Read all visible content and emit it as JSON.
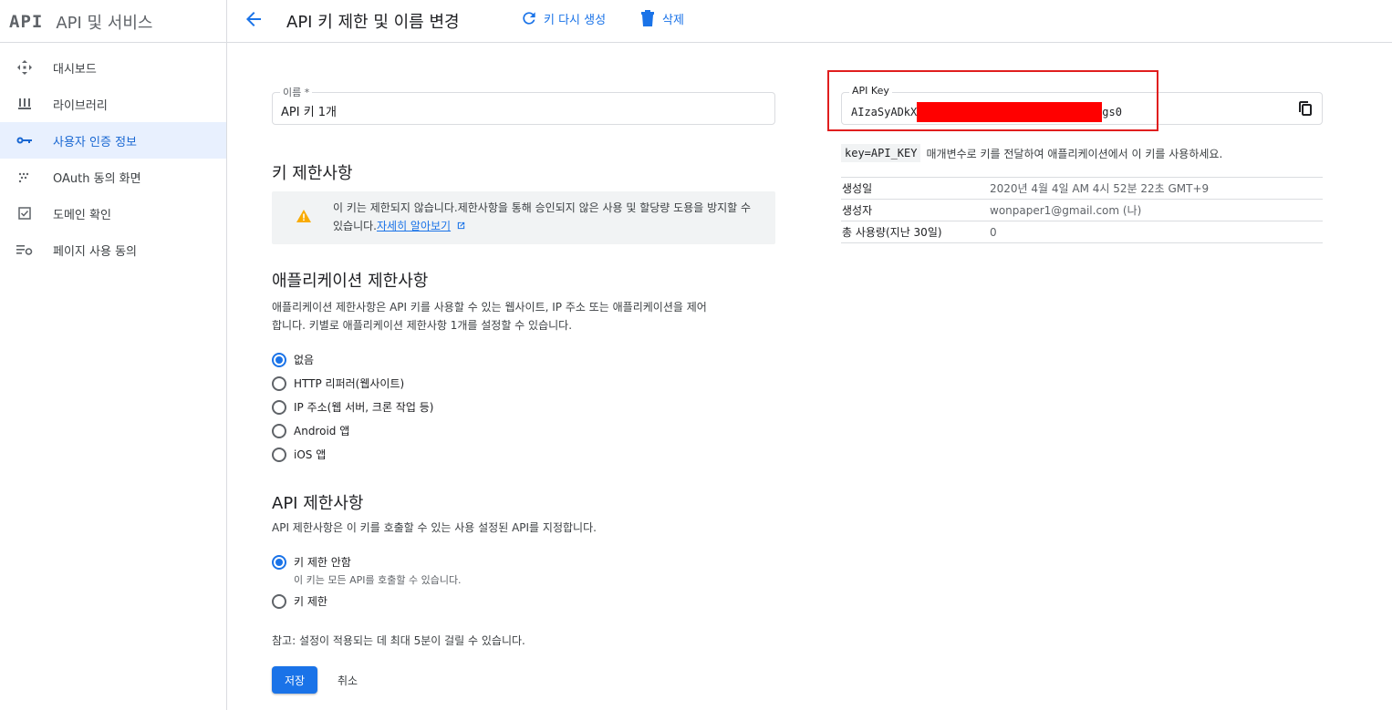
{
  "brand": {
    "logo": "API",
    "title": "API 및 서비스"
  },
  "header": {
    "title": "API 키 제한 및 이름 변경",
    "regenerate_label": "키 다시 생성",
    "delete_label": "삭제"
  },
  "sidebar": {
    "items": [
      {
        "label": "대시보드",
        "icon": "dashboard-icon",
        "active": false
      },
      {
        "label": "라이브러리",
        "icon": "library-icon",
        "active": false
      },
      {
        "label": "사용자 인증 정보",
        "icon": "key-icon",
        "active": true
      },
      {
        "label": "OAuth 동의 화면",
        "icon": "oauth-consent-icon",
        "active": false
      },
      {
        "label": "도메인 확인",
        "icon": "checkbox-icon",
        "active": false
      },
      {
        "label": "페이지 사용 동의",
        "icon": "settings-list-icon",
        "active": false
      }
    ]
  },
  "name_field": {
    "label": "이름 *",
    "value": "API 키 1개"
  },
  "key_restrictions": {
    "heading": "키 제한사항",
    "warning_text": "이 키는 제한되지 않습니다.제한사항을 통해 승인되지 않은 사용 및 할당량 도용을 방지할 수 있습니다.",
    "warning_link": "자세히 알아보기"
  },
  "app_restrictions": {
    "heading": "애플리케이션 제한사항",
    "description_line1": "애플리케이션 제한사항은 API 키를 사용할 수 있는 웹사이트, IP 주소 또는 애플리케이션을 제어",
    "description_line2": "합니다. 키별로 애플리케이션 제한사항 1개를 설정할 수 있습니다.",
    "options": [
      {
        "label": "없음",
        "selected": true
      },
      {
        "label": "HTTP 리퍼러(웹사이트)",
        "selected": false
      },
      {
        "label": "IP 주소(웹 서버, 크론 작업 등)",
        "selected": false
      },
      {
        "label": "Android 앱",
        "selected": false
      },
      {
        "label": "iOS 앱",
        "selected": false
      }
    ]
  },
  "api_restrictions": {
    "heading": "API 제한사항",
    "description": "API 제한사항은 이 키를 호출할 수 있는 사용 설정된 API를 지정합니다.",
    "options": [
      {
        "label": "키 제한 안함",
        "sublabel": "이 키는 모든 API를 호출할 수 있습니다.",
        "selected": true
      },
      {
        "label": "키 제한",
        "selected": false
      }
    ]
  },
  "note": "참고: 설정이 적용되는 데 최대 5분이 걸릴 수 있습니다.",
  "actions": {
    "save_label": "저장",
    "cancel_label": "취소"
  },
  "api_key": {
    "label": "API Key",
    "value_prefix": "AIzaSyADkX",
    "value_suffix": "gs0",
    "hint_code": "key=API_KEY",
    "hint_text": "매개변수로 키를 전달하여 애플리케이션에서 이 키를 사용하세요."
  },
  "key_info": [
    {
      "key": "생성일",
      "value": "2020년 4월 4일 AM 4시 52분 22초 GMT+9"
    },
    {
      "key": "생성자",
      "value": "wonpaper1@gmail.com (나)"
    },
    {
      "key": "총 사용량(지난 30일)",
      "value": "0"
    }
  ],
  "colors": {
    "accent": "#1a73e8",
    "highlight_border": "#e01e1e",
    "redaction": "#ff0000",
    "warning": "#f9ab00"
  }
}
